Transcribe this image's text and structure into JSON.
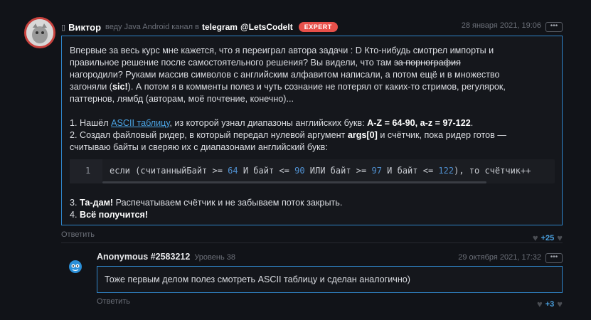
{
  "colors": {
    "background": "#111318",
    "accent": "#2f85c9",
    "badge": "#e8504a",
    "link": "#4ba3e3"
  },
  "comment": {
    "prefix_icon": "telegram-icon",
    "author": "Виктор",
    "role_text": "веду Java Android канал в",
    "telegram_label": "telegram",
    "telegram_handle": "@LetsCodeIt",
    "badge": "EXPERT",
    "date": "28 января 2021, 19:06",
    "more": "•••",
    "lines": {
      "l1": "Впервые за весь курс мне кажется, что я переиграл автора задачи : D Кто-нибудь смотрел импорты и",
      "l2": "правильное решение после самостоятельного решения? Вы видели, что там ",
      "l2_strike": "за порнография",
      "l3": "нагородили? Руками массив символов с английским алфавитом написали, а потом ещё и в множество",
      "l4_a": "загоняли (",
      "l4_b": "sic!",
      "l4_c": "). А потом я в комменты полез и чуть сознание не потерял от каких-то стримов, регулярок,",
      "l5": "паттернов, лямбд (авторам, моё почтение, конечно)...",
      "s1_a": "1. Нашёл ",
      "s1_link": "ASCII таблицу",
      "s1_b": ", из которой узнал диапазоны английских букв: ",
      "s1_c": "A-Z = 64-90, a-z = 97-122",
      "s1_d": ".",
      "s2_a": "2. Создал файловый ридер, в который передал нулевой аргумент ",
      "s2_b": "args[0]",
      "s2_c": " и счётчик, пока ридер готов —",
      "s2_d": "считываю байты и сверяю их с диапазонами английский букв:",
      "s3_a": "3. ",
      "s3_b": "Та-дам!",
      "s3_c": " Распечатываем счётчик и не забываем поток закрыть.",
      "s4_a": "4. ",
      "s4_b": "Всё получится!"
    },
    "code": {
      "line_number": "1",
      "t1": "если (считанныйБайт >= ",
      "n1": "64",
      "t2": " И байт <= ",
      "n2": "90",
      "t3": " ИЛИ байт >= ",
      "n3": "97",
      "t4": " И байт <= ",
      "n4": "122",
      "t5": "), то счётчик++"
    },
    "reply_label": "Ответить",
    "score": "+25"
  },
  "reply": {
    "author": "Anonymous #2583212",
    "level": "Уровень 38",
    "date": "29 октября 2021, 17:32",
    "more": "•••",
    "text": "Тоже первым делом полез смотреть ASCII таблицу и сделан аналогично)",
    "reply_label": "Ответить",
    "score": "+3"
  }
}
